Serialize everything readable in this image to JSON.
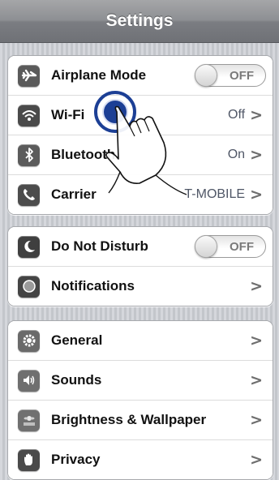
{
  "nav": {
    "title": "Settings"
  },
  "groups": [
    {
      "rows": [
        {
          "label": "Airplane Mode",
          "control": "switch",
          "switch_text": "OFF",
          "icon": "airplane-icon",
          "icon_bg": "#5a5a5a"
        },
        {
          "label": "Wi-Fi",
          "value": "Off",
          "icon": "wifi-icon",
          "icon_bg": "#4a4a4a"
        },
        {
          "label": "Bluetooth",
          "value": "On",
          "icon": "bluetooth-icon",
          "icon_bg": "#5b5b5b"
        },
        {
          "label": "Carrier",
          "value": "T-MOBILE",
          "icon": "phone-icon",
          "icon_bg": "#4c4c4c"
        }
      ]
    },
    {
      "rows": [
        {
          "label": "Do Not Disturb",
          "control": "switch",
          "switch_text": "OFF",
          "icon": "moon-icon",
          "icon_bg": "#3f3f3f"
        },
        {
          "label": "Notifications",
          "icon": "notifications-icon",
          "icon_bg": "#444444"
        }
      ]
    },
    {
      "rows": [
        {
          "label": "General",
          "icon": "gear-icon",
          "icon_bg": "#6a6a6a"
        },
        {
          "label": "Sounds",
          "icon": "speaker-icon",
          "icon_bg": "#6f6f6f"
        },
        {
          "label": "Brightness & Wallpaper",
          "icon": "flower-icon",
          "icon_bg": "#707070"
        },
        {
          "label": "Privacy",
          "icon": "hand-icon",
          "icon_bg": "#4a4a4a"
        }
      ]
    }
  ],
  "chevron": ">"
}
